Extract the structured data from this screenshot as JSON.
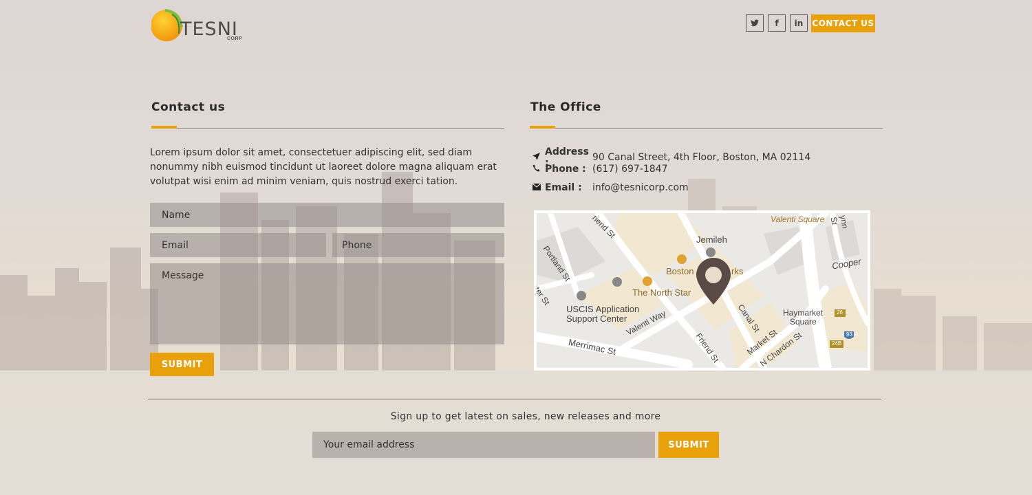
{
  "brand": {
    "name": "TESNI",
    "sub": "CORP",
    "accent_color": "#e8a00b"
  },
  "header": {
    "social": [
      {
        "icon": "twitter-icon",
        "glyph": "🐦"
      },
      {
        "icon": "facebook-icon",
        "glyph": "f"
      },
      {
        "icon": "linkedin-icon",
        "glyph": "in"
      }
    ],
    "contact_label": "CONTACT US"
  },
  "contact": {
    "title": "Contact us",
    "intro": "Lorem ipsum dolor sit amet, consectetuer adipiscing elit, sed diam nonummy nibh euismod tincidunt ut laoreet dolore magna aliquam erat volutpat wisi enim ad minim veniam, quis nostrud exerci tation.",
    "name_placeholder": "Name",
    "email_placeholder": "Email",
    "phone_placeholder": "Phone",
    "message_placeholder": "Message",
    "submit_label": "SUBMIT"
  },
  "office": {
    "title": "The Office",
    "address_label": "Address :",
    "address": "90 Canal Street, 4th Floor, Boston, MA 02114",
    "phone_label": "Phone :",
    "phone": "(617) 697-1847",
    "email_label": "Email :",
    "email": "info@tesnicorp.com",
    "map_labels": {
      "valenti_square": "Valenti Square",
      "jemileh": "Jemileh",
      "boston": "Boston",
      "rks": "rks",
      "north_star": "The North Star",
      "uscis1": "USCIS Application",
      "uscis2": "Support Center",
      "haymarket1": "Haymarket",
      "haymarket2": "Square",
      "cooper": "Cooper",
      "portland": "Portland St",
      "friend_top": "riend St",
      "valenti_way": "Valenti Way",
      "merrimac": "Merrimac St",
      "friend": "Friend St",
      "canal": "Canal St",
      "market": "Market St",
      "chardon": "N Chardon St",
      "ster": "ster St",
      "lynn": "ynn St",
      "r26": "26",
      "r24b": "24B",
      "r93": "93"
    }
  },
  "newsletter": {
    "text": "Sign up to get latest on sales, new releases and more",
    "placeholder": "Your email address",
    "submit_label": "SUBMIT"
  }
}
